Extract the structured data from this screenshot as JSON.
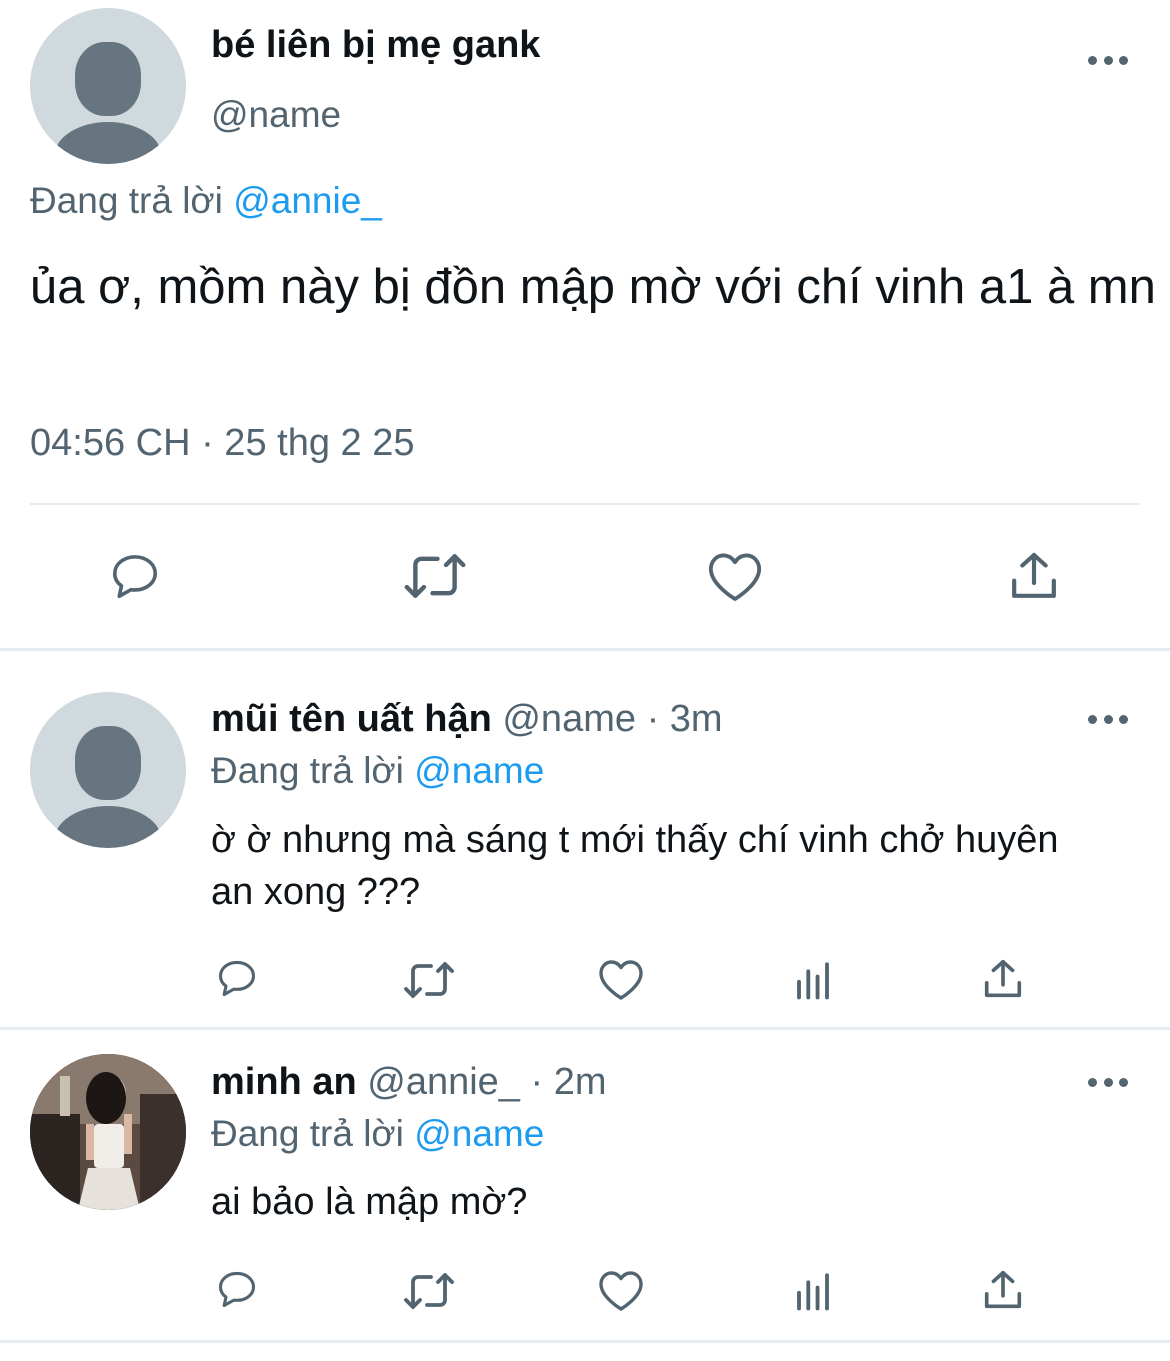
{
  "main_tweet": {
    "display_name": "bé liên bị mẹ gank",
    "handle": "@name",
    "replying_label": "Đang trả lời",
    "replying_to": "@annie_",
    "text": "ủa ơ, mồm này bị đồn mập mờ với chí vinh a1 à mn",
    "timestamp": "04:56 CH · 25 thg 2 25",
    "actions": [
      "reply-icon",
      "retweet-icon",
      "like-icon",
      "share-icon"
    ]
  },
  "replies": [
    {
      "display_name": "mũi tên uất hận",
      "handle": "@name",
      "separator": "·",
      "time": "3m",
      "replying_label": "Đang trả lời",
      "replying_to": "@name",
      "text": "ờ ờ nhưng mà sáng t mới thấy chí vinh chở huyên an xong ???",
      "avatar": "default-avatar",
      "actions": [
        "reply-icon",
        "retweet-icon",
        "like-icon",
        "views-icon",
        "share-icon"
      ]
    },
    {
      "display_name": "minh an",
      "handle": "@annie_",
      "separator": "·",
      "time": "2m",
      "replying_label": "Đang trả lời",
      "replying_to": "@name",
      "text": "ai bảo là mập mờ?",
      "avatar": "photo-avatar",
      "actions": [
        "reply-icon",
        "retweet-icon",
        "like-icon",
        "views-icon",
        "share-icon"
      ]
    }
  ],
  "colors": {
    "text": "#0f1419",
    "secondary": "#536471",
    "link": "#1d9bf0",
    "divider": "#e6ecf0"
  }
}
